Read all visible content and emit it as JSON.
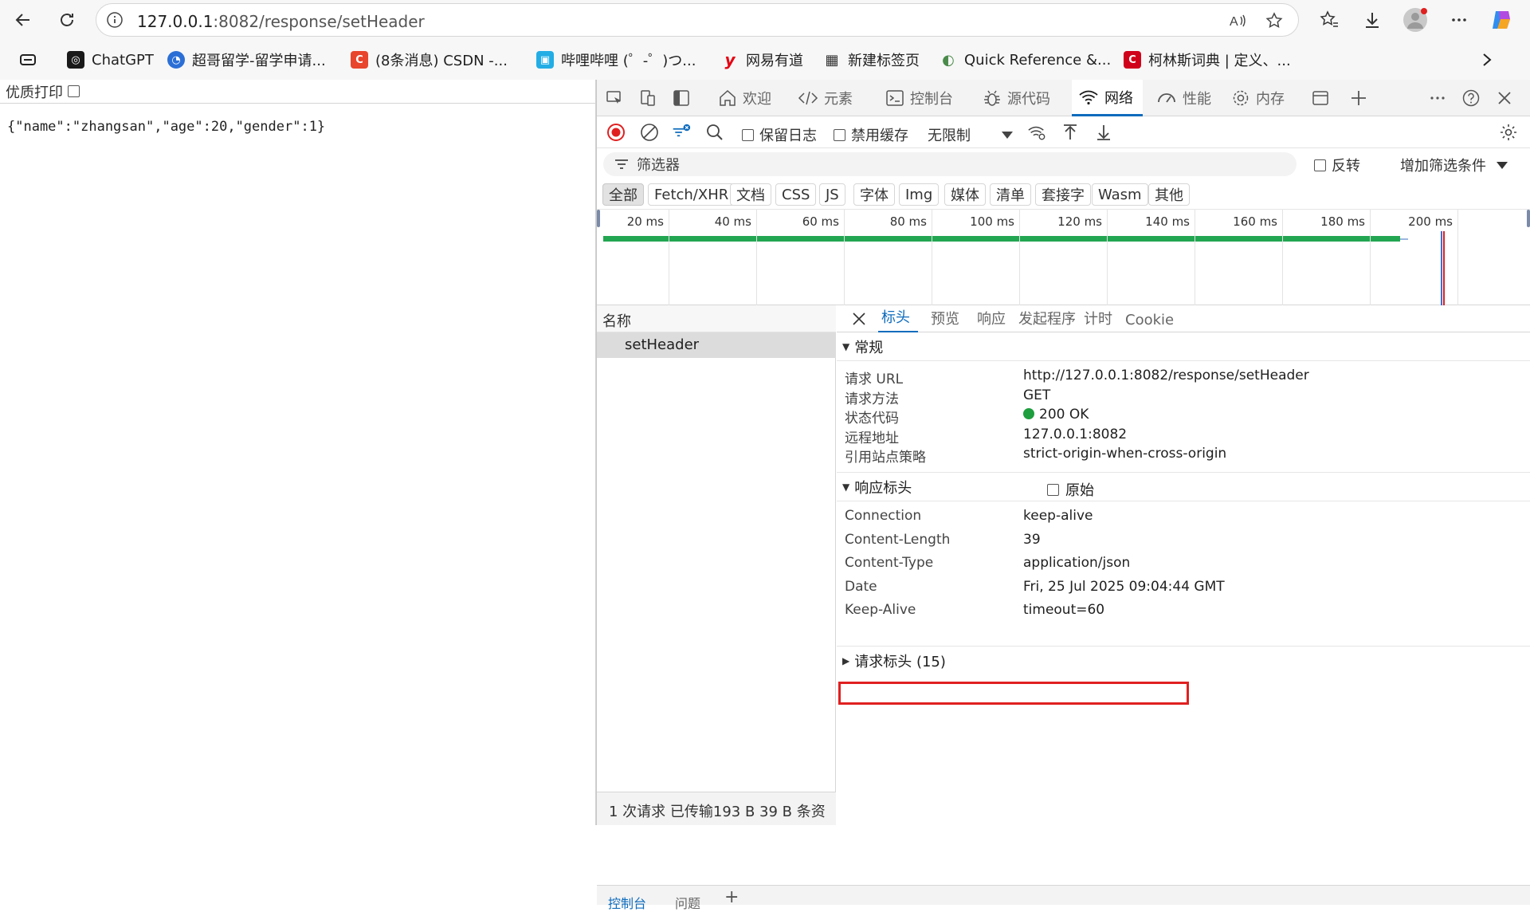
{
  "browser": {
    "url_host": "127.0.0.1",
    "url_path": ":8082/response/setHeader",
    "bookmarks": [
      {
        "label": "ChatGPT",
        "icon": "chatgpt-icon",
        "color": "#1a1a1a",
        "glyph": "◎"
      },
      {
        "label": "超哥留学-留学申请...",
        "icon": "chaoge-icon",
        "color": "#2b6fd6",
        "glyph": "◔"
      },
      {
        "label": "(8条消息) CSDN -...",
        "icon": "csdn-icon",
        "color": "#e8452c",
        "glyph": "C"
      },
      {
        "label": "哔哩哔哩 (゜-゜)つ...",
        "icon": "bilibili-icon",
        "color": "#23ade5",
        "glyph": "▣"
      },
      {
        "label": "网易有道",
        "icon": "youdao-icon",
        "color": "#e60012",
        "glyph": "y"
      },
      {
        "label": "新建标签页",
        "icon": "newtab-icon",
        "color": "#333333",
        "glyph": "▦"
      },
      {
        "label": "Quick Reference &...",
        "icon": "quickref-icon",
        "color": "#4a8a4a",
        "glyph": "◐"
      },
      {
        "label": "柯林斯词典 | 定义、...",
        "icon": "collins-icon",
        "color": "#d0021b",
        "glyph": "C"
      }
    ]
  },
  "page": {
    "print_label": "优质打印",
    "json_text": "{\"name\":\"zhangsan\",\"age\":20,\"gender\":1}"
  },
  "devtools": {
    "tabs": [
      {
        "label": "欢迎",
        "icon": "home-icon"
      },
      {
        "label": "元素",
        "icon": "code-icon"
      },
      {
        "label": "控制台",
        "icon": "console-icon"
      },
      {
        "label": "源代码",
        "icon": "bug-icon"
      },
      {
        "label": "网络",
        "icon": "wifi-icon"
      },
      {
        "label": "性能",
        "icon": "gauge-icon"
      },
      {
        "label": "内存",
        "icon": "gear-icon"
      }
    ],
    "toolbar": {
      "preserve_log": "保留日志",
      "disable_cache": "禁用缓存",
      "throttle": "无限制"
    },
    "filter": {
      "placeholder": "筛选器",
      "invert": "反转",
      "more_filters": "增加筛选条件"
    },
    "type_chips": [
      "全部",
      "Fetch/XHR",
      "文档",
      "CSS",
      "JS",
      "字体",
      "Img",
      "媒体",
      "清单",
      "套接字",
      "Wasm",
      "其他"
    ],
    "timeline_ticks": [
      "20 ms",
      "40 ms",
      "60 ms",
      "80 ms",
      "100 ms",
      "120 ms",
      "140 ms",
      "160 ms",
      "180 ms",
      "200 ms"
    ],
    "name_header": "名称",
    "request_name": "setHeader",
    "detail_tabs": [
      "标头",
      "预览",
      "响应",
      "发起程序",
      "计时",
      "Cookie"
    ],
    "general": {
      "title": "常规",
      "rows": [
        {
          "k": "请求 URL",
          "v": "http://127.0.0.1:8082/response/setHeader"
        },
        {
          "k": "请求方法",
          "v": "GET"
        },
        {
          "k": "状态代码",
          "v": "200 OK"
        },
        {
          "k": "远程地址",
          "v": "127.0.0.1:8082"
        },
        {
          "k": "引用站点策略",
          "v": "strict-origin-when-cross-origin"
        }
      ]
    },
    "response_headers": {
      "title": "响应标头",
      "raw_label": "原始",
      "rows": [
        {
          "k": "Connection",
          "v": "keep-alive"
        },
        {
          "k": "Content-Length",
          "v": "39"
        },
        {
          "k": "Content-Type",
          "v": "application/json"
        },
        {
          "k": "Date",
          "v": "Fri, 25 Jul 2025 09:04:44 GMT"
        },
        {
          "k": "Keep-Alive",
          "v": "timeout=60"
        }
      ]
    },
    "request_headers_title": "请求标头 (15)",
    "status_bar": "1 次请求   已传输193 B   39 B 条资",
    "drawer_tabs": [
      "控制台",
      "问题"
    ],
    "colors": {
      "accent": "#0f6cbd",
      "status_ok": "#1e9e3e",
      "highlight": "#e02020",
      "record": "#e02020"
    }
  }
}
